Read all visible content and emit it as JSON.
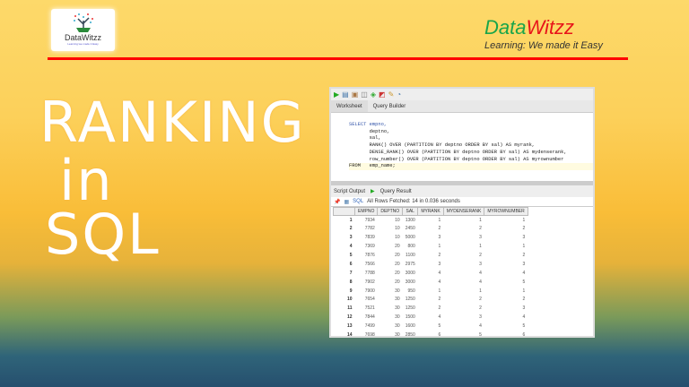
{
  "logo": {
    "name": "DataWitzz",
    "tagline": "Learning:we made it Easy"
  },
  "brand": {
    "part1": "Data",
    "part2": "Witzz",
    "tagline": "Learning: We made it Easy"
  },
  "title": {
    "line1": "RANKING",
    "line2": "in",
    "line3": "SQL"
  },
  "colors": {
    "accent_red": "#ff0000",
    "brand_green": "#1aa54a",
    "brand_red": "#e8141a"
  },
  "editor": {
    "tabs": [
      "Worksheet",
      "Query Builder"
    ],
    "lines": [
      "SELECT empno,",
      "       deptno,",
      "       sal,",
      "       RANK() OVER (PARTITION BY deptno ORDER BY sal) AS myrank,",
      "       DENSE_RANK() OVER (PARTITION BY deptno ORDER BY sal) AS mydenserank,",
      "       row_number() OVER (PARTITION BY deptno ORDER BY sal) AS myrownumber",
      "FROM   emp_name;"
    ]
  },
  "results": {
    "tabs": [
      "Script Output",
      "Query Result"
    ],
    "sql_label": "SQL",
    "status": "All Rows Fetched: 14 in 0.036 seconds",
    "columns": [
      "EMPNO",
      "DEPTNO",
      "SAL",
      "MYRANK",
      "MYDENSERANK",
      "MYROWNUMBER"
    ],
    "rows": [
      [
        "1",
        "7934",
        "10",
        "1300",
        "1",
        "1",
        "1"
      ],
      [
        "2",
        "7782",
        "10",
        "2450",
        "2",
        "2",
        "2"
      ],
      [
        "3",
        "7839",
        "10",
        "5000",
        "3",
        "3",
        "3"
      ],
      [
        "4",
        "7369",
        "20",
        "800",
        "1",
        "1",
        "1"
      ],
      [
        "5",
        "7876",
        "20",
        "1100",
        "2",
        "2",
        "2"
      ],
      [
        "6",
        "7566",
        "20",
        "2975",
        "3",
        "3",
        "3"
      ],
      [
        "7",
        "7788",
        "20",
        "3000",
        "4",
        "4",
        "4"
      ],
      [
        "8",
        "7902",
        "20",
        "3000",
        "4",
        "4",
        "5"
      ],
      [
        "9",
        "7900",
        "30",
        "950",
        "1",
        "1",
        "1"
      ],
      [
        "10",
        "7654",
        "30",
        "1250",
        "2",
        "2",
        "2"
      ],
      [
        "11",
        "7521",
        "30",
        "1250",
        "2",
        "2",
        "3"
      ],
      [
        "12",
        "7844",
        "30",
        "1500",
        "4",
        "3",
        "4"
      ],
      [
        "13",
        "7499",
        "30",
        "1600",
        "5",
        "4",
        "5"
      ],
      [
        "14",
        "7698",
        "30",
        "2850",
        "6",
        "5",
        "6"
      ]
    ]
  }
}
